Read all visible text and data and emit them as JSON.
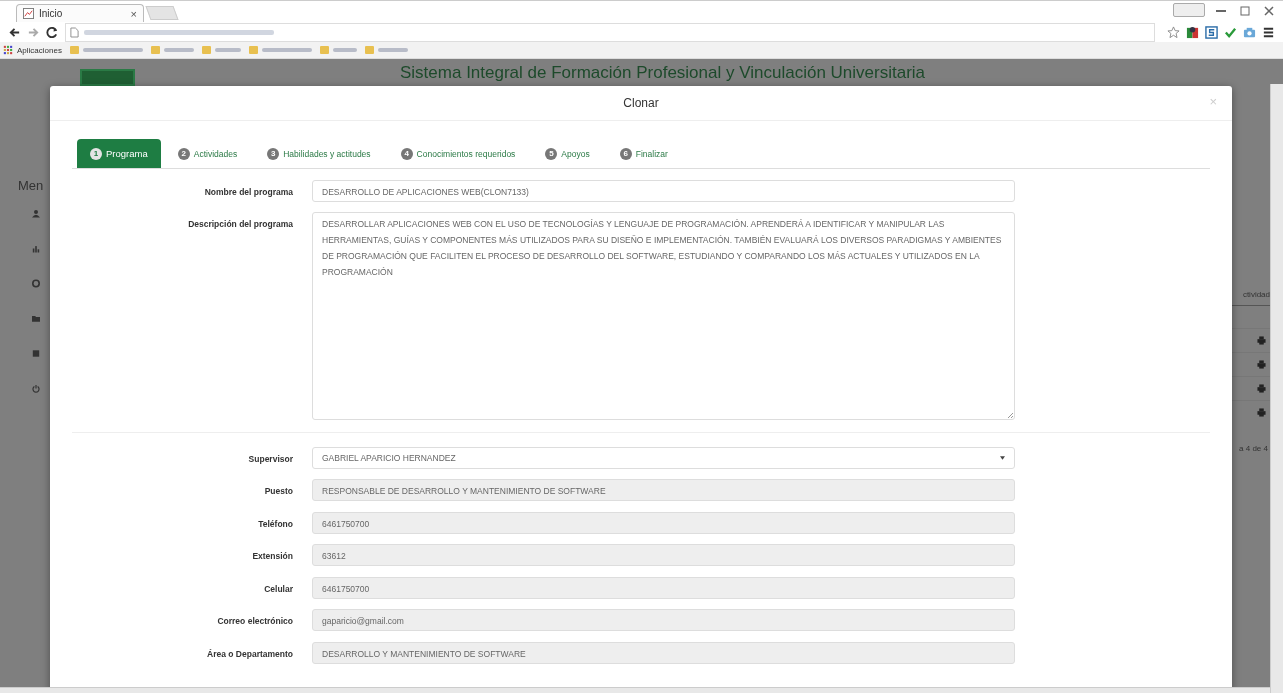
{
  "browser": {
    "tab_title": "Inicio",
    "tab_close": "×",
    "bookmarks_label": "Aplicaciones"
  },
  "background": {
    "header_title": "Sistema Integral de Formación Profesional y Vinculación Universitaria",
    "menu_label": "Men",
    "table_header": "ctividad",
    "pagination": "a 4 de 4"
  },
  "modal": {
    "title": "Clonar",
    "close": "×",
    "tabs": [
      {
        "number": "1",
        "label": "Programa",
        "selected": true
      },
      {
        "number": "2",
        "label": "Actividades",
        "selected": false
      },
      {
        "number": "3",
        "label": "Habilidades y actitudes",
        "selected": false
      },
      {
        "number": "4",
        "label": "Conocimientos requeridos",
        "selected": false
      },
      {
        "number": "5",
        "label": "Apoyos",
        "selected": false
      },
      {
        "number": "6",
        "label": "Finalizar",
        "selected": false
      }
    ],
    "fields": [
      {
        "kind": "text",
        "label": "Nombre del programa",
        "value": "DESARROLLO DE APLICACIONES WEB(CLON7133)"
      },
      {
        "kind": "textarea",
        "label": "Descripción del programa",
        "value": "DESARROLLAR APLICACIONES WEB CON EL USO DE TECNOLOGÍAS Y LENGUAJE DE PROGRAMACIÓN. APRENDERÁ A IDENTIFICAR Y MANIPULAR LAS HERRAMIENTAS, GUÍAS Y COMPONENTES MÁS UTILIZADOS PARA SU DISEÑO E IMPLEMENTACIÓN. TAMBIÉN EVALUARÁ LOS DIVERSOS PARADIGMAS Y AMBIENTES DE PROGRAMACIÓN QUE FACILITEN EL PROCESO DE DESARROLLO DEL SOFTWARE, ESTUDIANDO Y COMPARANDO LOS MÁS ACTUALES Y UTILIZADOS EN LA PROGRAMACIÓN"
      },
      {
        "kind": "divider"
      },
      {
        "kind": "select",
        "label": "Supervisor",
        "value": "GABRIEL APARICIO HERNANDEZ"
      },
      {
        "kind": "readonly",
        "label": "Puesto",
        "value": "RESPONSABLE DE DESARROLLO Y MANTENIMIENTO DE SOFTWARE"
      },
      {
        "kind": "readonly",
        "label": "Teléfono",
        "value": "6461750700"
      },
      {
        "kind": "readonly",
        "label": "Extensión",
        "value": "63612"
      },
      {
        "kind": "readonly",
        "label": "Celular",
        "value": "6461750700"
      },
      {
        "kind": "readonly",
        "label": "Correo electrónico",
        "value": "gaparicio@gmail.com"
      },
      {
        "kind": "readonly",
        "label": "Área o Departamento",
        "value": "DESARROLLO Y MANTENIMIENTO DE SOFTWARE"
      }
    ]
  }
}
